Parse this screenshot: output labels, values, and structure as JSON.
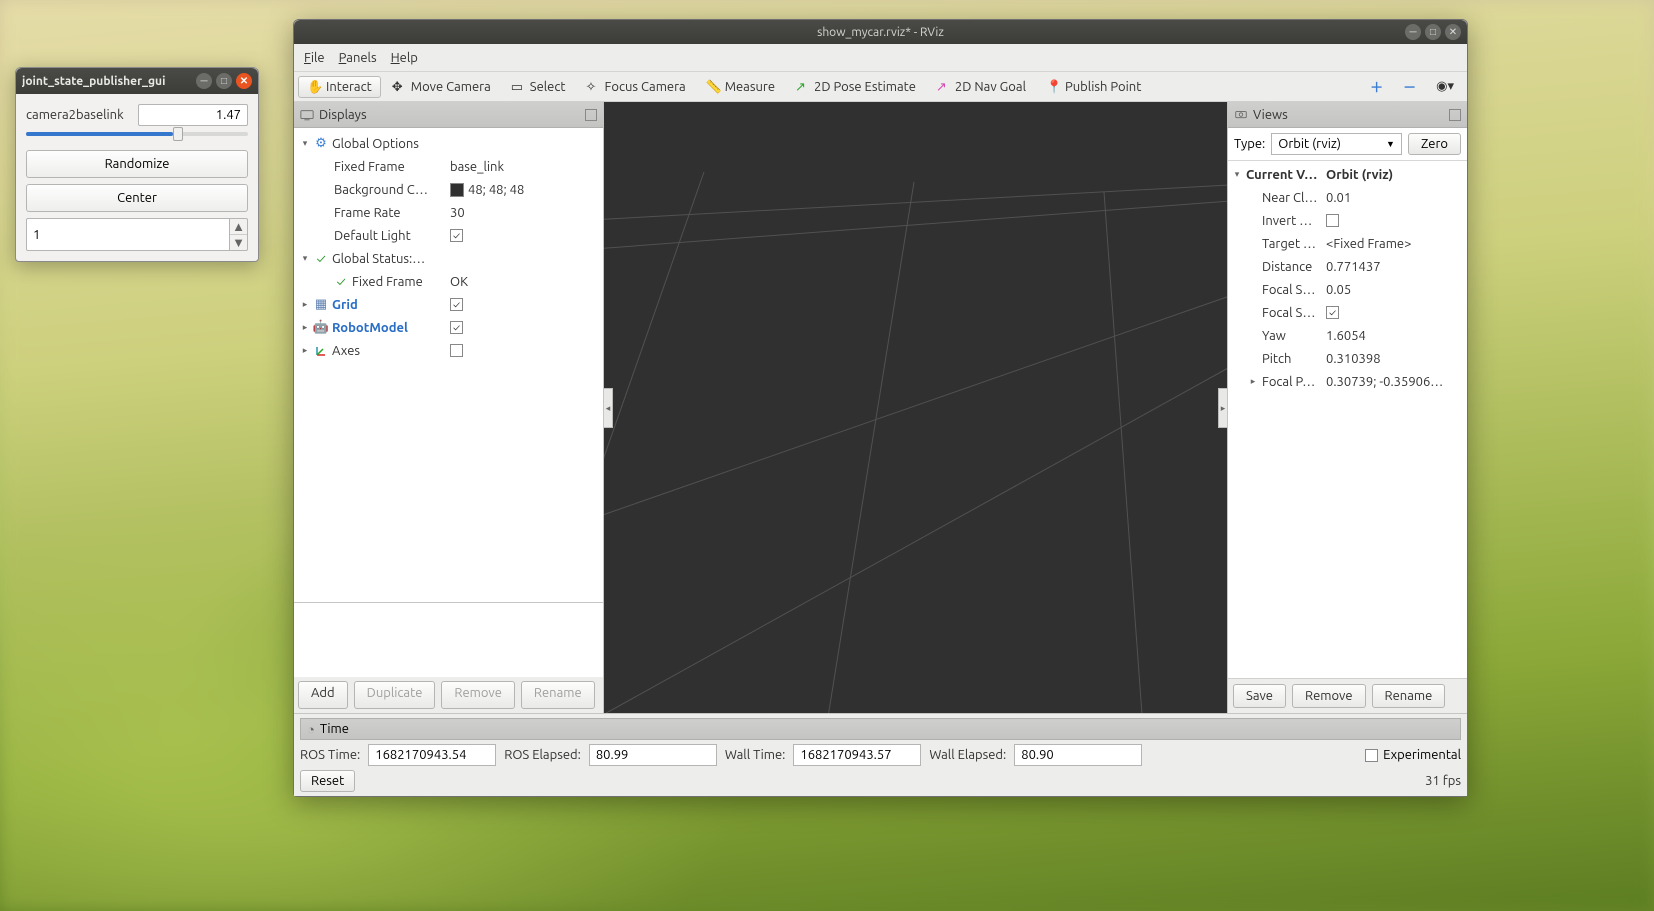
{
  "jsp": {
    "title": "joint_state_publisher_gui",
    "param_label": "camera2baselink",
    "param_value": "1.47",
    "slider_percent": 66,
    "randomize": "Randomize",
    "center": "Center",
    "spinner_value": "1"
  },
  "rviz": {
    "title": "show_mycar.rviz* - RViz",
    "menus": {
      "file": "File",
      "panels": "Panels",
      "help": "Help"
    },
    "tools": {
      "interact": "Interact",
      "move_camera": "Move Camera",
      "select": "Select",
      "focus_camera": "Focus Camera",
      "measure": "Measure",
      "pose_estimate": "2D Pose Estimate",
      "nav_goal": "2D Nav Goal",
      "publish_point": "Publish Point"
    },
    "displays": {
      "title": "Displays",
      "global_options": "Global Options",
      "fixed_frame": {
        "label": "Fixed Frame",
        "value": "base_link"
      },
      "bg_color": {
        "label": "Background C…",
        "value": "48; 48; 48"
      },
      "frame_rate": {
        "label": "Frame Rate",
        "value": "30"
      },
      "default_light": {
        "label": "Default Light"
      },
      "global_status": "Global Status:…",
      "status_fixed_frame": {
        "label": "Fixed Frame",
        "value": "OK"
      },
      "grid": "Grid",
      "robot_model": "RobotModel",
      "axes": "Axes",
      "btn_add": "Add",
      "btn_duplicate": "Duplicate",
      "btn_remove": "Remove",
      "btn_rename": "Rename"
    },
    "views": {
      "title": "Views",
      "type_label": "Type:",
      "type_value": "Orbit (rviz)",
      "zero": "Zero",
      "current_view": {
        "label": "Current V…",
        "value": "Orbit (rviz)"
      },
      "near_clip": {
        "label": "Near Cl…",
        "value": "0.01"
      },
      "invert": {
        "label": "Invert …"
      },
      "target": {
        "label": "Target …",
        "value": "<Fixed Frame>"
      },
      "distance": {
        "label": "Distance",
        "value": "0.771437"
      },
      "focal_shape_size": {
        "label": "Focal S…",
        "value": "0.05"
      },
      "focal_shape_fixed": {
        "label": "Focal S…"
      },
      "yaw": {
        "label": "Yaw",
        "value": "1.6054"
      },
      "pitch": {
        "label": "Pitch",
        "value": "0.310398"
      },
      "focal_point": {
        "label": "Focal P…",
        "value": "0.30739; -0.35906…"
      },
      "save": "Save",
      "remove": "Remove",
      "rename": "Rename"
    },
    "time": {
      "title": "Time",
      "ros_time_label": "ROS Time:",
      "ros_time": "1682170943.54",
      "ros_elapsed_label": "ROS Elapsed:",
      "ros_elapsed": "80.99",
      "wall_time_label": "Wall Time:",
      "wall_time": "1682170943.57",
      "wall_elapsed_label": "Wall Elapsed:",
      "wall_elapsed": "80.90",
      "experimental": "Experimental",
      "reset": "Reset",
      "fps": "31 fps"
    }
  }
}
